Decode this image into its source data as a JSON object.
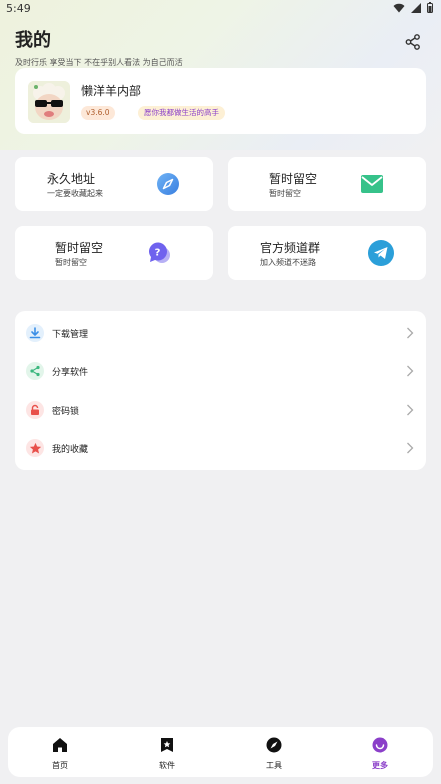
{
  "status": {
    "time": "5:49"
  },
  "header": {
    "title": "我的",
    "subtitle": "及时行乐 享受当下 不在乎别人看法 为自己而活"
  },
  "profile": {
    "name": "懒洋羊内部",
    "version": "v3.6.0",
    "slogan": "愿你我都做生活的高手"
  },
  "grid_cards": [
    {
      "title": "永久地址",
      "subtitle": "一定要收藏起来",
      "icon": "compass-icon",
      "color": "#4a90e2"
    },
    {
      "title": "暂时留空",
      "subtitle": "暂时留空",
      "icon": "mail-icon",
      "color": "#2ec27e"
    },
    {
      "title": "暂时留空",
      "subtitle": "暂时留空",
      "icon": "question-chat-icon",
      "color": "#7b6cf6"
    },
    {
      "title": "官方频道群",
      "subtitle": "加入频道不迷路",
      "icon": "telegram-icon",
      "color": "#2b9fd9"
    }
  ],
  "menu": [
    {
      "label": "下载管理",
      "icon": "download-icon",
      "color": "#3a8ee6"
    },
    {
      "label": "分享软件",
      "icon": "share-icon",
      "color": "#3bb77e"
    },
    {
      "label": "密码锁",
      "icon": "lock-icon",
      "color": "#e8504a"
    },
    {
      "label": "我的收藏",
      "icon": "star-icon",
      "color": "#e8504a"
    }
  ],
  "nav": {
    "active": "更多",
    "items": [
      {
        "label": "首页",
        "icon": "home-icon"
      },
      {
        "label": "软件",
        "icon": "bookmark-star-icon"
      },
      {
        "label": "工具",
        "icon": "compass-icon"
      },
      {
        "label": "更多",
        "icon": "smile-icon"
      }
    ]
  },
  "colors": {
    "accent": "#8b3fc9",
    "background": "#f0f0f2"
  }
}
